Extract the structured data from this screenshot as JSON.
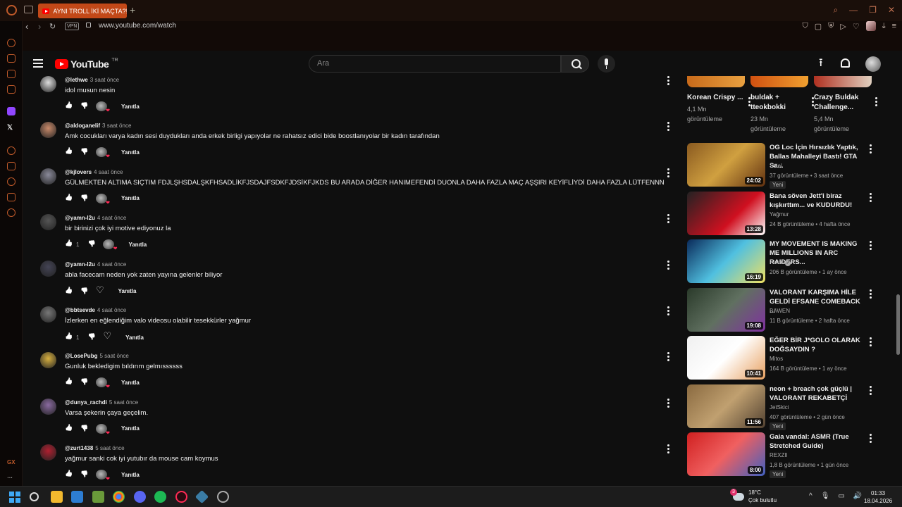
{
  "browser": {
    "tab_title": "AYNI TROLL İKİ MAÇTA?! |",
    "url": "www.youtube.com/watch",
    "vpn_label": "VPN",
    "sidebar_label": "GX"
  },
  "header": {
    "logo_text": "YouTube",
    "country": "TR",
    "search_placeholder": "Ara"
  },
  "comments": [
    {
      "author": "@lethwe",
      "ago": "3 saat önce",
      "text": "idol musun nesin",
      "likes": "",
      "hearted": true
    },
    {
      "author": "@aldoganelif",
      "ago": "3 saat önce",
      "text": "Amk cocukları varya kadın sesi duydukları anda erkek birligi yapıyolar ne rahatsız edici bide boostlanıyolar bir kadın tarafından",
      "likes": "",
      "hearted": true
    },
    {
      "author": "@kjlovers",
      "ago": "4 saat önce",
      "text": "GÜLMEKTEN ALTIMA SIÇTIM FDJLŞHSDALŞKFHSADLİKFJSDAJFSDKFJDSİKFJKDS BU ARADA DİĞER HANIMEFENDİ DUONLA DAHA FAZLA MAÇ AŞŞIRI KEYİFLİYDİ DAHA FAZLA LÜTFENNN",
      "likes": "",
      "hearted": true
    },
    {
      "author": "@yamn-l2u",
      "ago": "4 saat önce",
      "text": "bir birinizi çok iyi motive ediyonuz la",
      "likes": "1",
      "hearted": true
    },
    {
      "author": "@yamn-l2u",
      "ago": "4 saat önce",
      "text": "abla facecam neden yok zaten yayına gelenler biliyor",
      "likes": "",
      "hearted": false
    },
    {
      "author": "@bbtsevde",
      "ago": "4 saat önce",
      "text": "İzlerken en eğlendiğim valo videosu olabilir tesekkürler yağmur",
      "likes": "1",
      "hearted": false
    },
    {
      "author": "@LosePubg",
      "ago": "5 saat önce",
      "text": "Gunluk bekledigim bıldırım gelmıssssss",
      "likes": "",
      "hearted": true
    },
    {
      "author": "@dunya_rachdi",
      "ago": "5 saat önce",
      "text": "Varsa şekerin çaya geçelim.",
      "likes": "",
      "hearted": true
    },
    {
      "author": "@zurt1438",
      "ago": "5 saat önce",
      "text": "yağmur sanki cok iyi yutubır da mouse cam koymus",
      "likes": "",
      "hearted": true
    }
  ],
  "reply_label": "Yanıtla",
  "top_cards": [
    {
      "title": "Korean Crispy ...",
      "views": "4,1 Mn",
      "views_label": "görüntüleme"
    },
    {
      "title": "buldak + tteokbokki",
      "views": "23 Mn",
      "views_label": "görüntüleme"
    },
    {
      "title": "Crazy Buldak Challenge...",
      "views": "5,4 Mn",
      "views_label": "görüntüleme"
    }
  ],
  "recommendations": [
    {
      "title": "OG Loc İçin Hırsızlık Yaptık, Ballas Mahalleyi Bastı! GTA Sa...",
      "channel": "Sttiel",
      "meta": "37 görüntüleme • 3 saat önce",
      "duration": "24:02",
      "badge": "Yeni",
      "verified": false
    },
    {
      "title": "Bana söven Jett'i biraz kışkırttım... ve KUDURDU!",
      "channel": "Yağmur",
      "meta": "24 B görüntüleme • 4 hafta önce",
      "duration": "13:28",
      "badge": "",
      "verified": false
    },
    {
      "title": "MY MOVEMENT IS MAKING ME MILLIONS IN ARC RAIDERS...",
      "channel": "Faide",
      "meta": "206 B görüntüleme • 1 ay önce",
      "duration": "16:19",
      "badge": "",
      "verified": true
    },
    {
      "title": "VALORANT KARŞIMA HİLE GELDİ EFSANE COMEBACK ...",
      "channel": "BAWEN",
      "meta": "11 B görüntüleme • 2 hafta önce",
      "duration": "19:08",
      "badge": "",
      "verified": false
    },
    {
      "title": "EĞER BİR J*GOLO OLARAK DOĞSAYDIN ?",
      "channel": "Mitos",
      "meta": "164 B görüntüleme • 1 ay önce",
      "duration": "10:41",
      "badge": "",
      "verified": false
    },
    {
      "title": "neon + breach çok güçlü | VALORANT REKABETÇİ",
      "channel": "JetSkici",
      "meta": "407 görüntüleme • 2 gün önce",
      "duration": "11:56",
      "badge": "Yeni",
      "verified": false
    },
    {
      "title": "Gaia vandal: ASMR (True Stretched Guide)",
      "channel": "REXZII",
      "meta": "1,8 B görüntüleme • 1 gün önce",
      "duration": "8:00",
      "badge": "Yeni",
      "verified": false
    }
  ],
  "taskbar": {
    "weather_temp": "18°C",
    "weather_desc": "Çok bulutlu",
    "weather_badge": "3",
    "time": "01:33",
    "date": "18.04.2026"
  },
  "colors": {
    "accent": "#c24818",
    "yt_red": "#ff0000",
    "background": "#0f0f0f"
  }
}
